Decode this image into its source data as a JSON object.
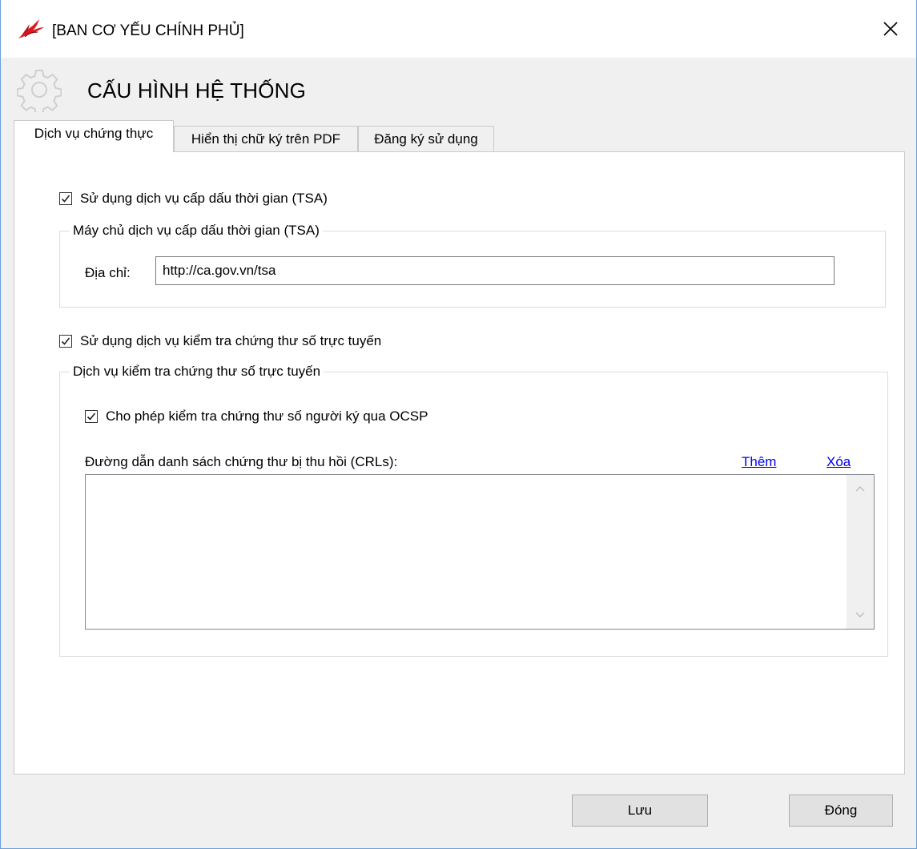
{
  "window": {
    "title": "[BAN CƠ YẾU CHÍNH PHỦ]",
    "logo_icon": "red-feather-logo",
    "close_icon": "close-icon"
  },
  "header": {
    "icon": "gear-icon",
    "title": "CẤU HÌNH HỆ THỐNG"
  },
  "tabs": [
    {
      "label": "Dịch vụ chứng thực",
      "active": true
    },
    {
      "label": "Hiển thị chữ ký trên PDF",
      "active": false
    },
    {
      "label": "Đăng ký sử dụng",
      "active": false
    }
  ],
  "tsa": {
    "checkbox_label": "Sử dụng dịch vụ cấp dấu thời gian (TSA)",
    "checked": true,
    "group_title": "Máy chủ dịch vụ cấp dấu thời gian (TSA)",
    "address_label": "Địa chỉ:",
    "address_value": "http://ca.gov.vn/tsa"
  },
  "online_check": {
    "checkbox_label": "Sử dụng dịch vụ kiểm tra chứng thư số trực tuyến",
    "checked": true,
    "group_title": "Dịch vụ kiểm tra chứng thư số trực tuyến",
    "ocsp_label": "Cho phép kiểm tra chứng thư số người ký qua OCSP",
    "ocsp_checked": true,
    "crl_label": "Đường dẫn danh sách chứng thư bị thu hồi (CRLs):",
    "add_link": "Thêm",
    "delete_link": "Xóa",
    "crl_items": []
  },
  "footer": {
    "save_label": "Lưu",
    "close_label": "Đóng"
  }
}
